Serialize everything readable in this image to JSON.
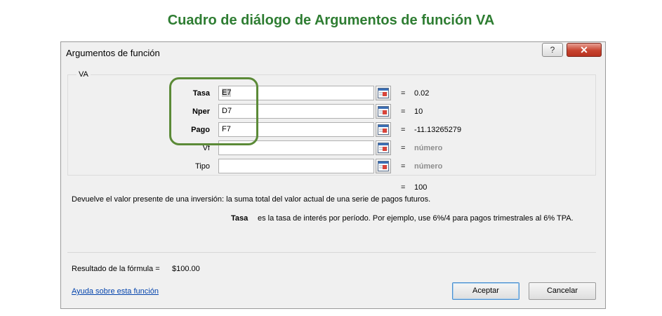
{
  "caption": "Cuadro de diálogo de Argumentos de función VA",
  "dialog": {
    "title": "Argumentos de función",
    "help_glyph": "?",
    "close_glyph": "✕",
    "function_name": "VA",
    "args": [
      {
        "label": "Tasa",
        "value": "E7",
        "result": "0.02",
        "bold": true,
        "result_gray": false
      },
      {
        "label": "Nper",
        "value": "D7",
        "result": "10",
        "bold": true,
        "result_gray": false
      },
      {
        "label": "Pago",
        "value": "F7",
        "result": "-11.13265279",
        "bold": true,
        "result_gray": false
      },
      {
        "label": "Vf",
        "value": "",
        "result": "número",
        "bold": false,
        "result_gray": true
      },
      {
        "label": "Tipo",
        "value": "",
        "result": "número",
        "bold": false,
        "result_gray": true
      }
    ],
    "equals": "=",
    "function_result": "100",
    "description": "Devuelve el valor presente de una inversión: la suma total del valor actual de una serie de pagos futuros.",
    "arg_desc_name": "Tasa",
    "arg_desc_text": "es la tasa de interés por período. Por ejemplo, use 6%/4 para pagos trimestrales al 6% TPA.",
    "formula_result_label": "Resultado de la fórmula =",
    "formula_result_value": "$100.00",
    "help_link": "Ayuda sobre esta función",
    "ok_label": "Aceptar",
    "cancel_label": "Cancelar"
  },
  "colors": {
    "caption": "#2e7d32",
    "highlight": "#5b8a37",
    "link": "#0645ad"
  },
  "icons": {
    "ref_button": "collapse-dialog-icon"
  }
}
